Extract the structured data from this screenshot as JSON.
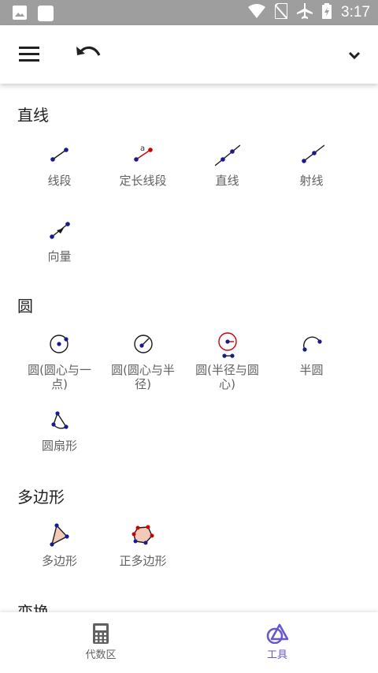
{
  "status_bar": {
    "time": "3:17",
    "icons": [
      "image-icon",
      "square-icon",
      "wifi-icon",
      "no-sim-icon",
      "airplane-icon",
      "battery-icon"
    ]
  },
  "toolbar": {
    "icons": [
      "menu-icon",
      "undo-icon",
      "chevron-down-icon"
    ]
  },
  "sections": [
    {
      "title": "直线",
      "tools": [
        {
          "label": "线段"
        },
        {
          "label": "定长线段",
          "glyph": "a"
        },
        {
          "label": "直线"
        },
        {
          "label": "射线"
        },
        {
          "label": "向量"
        }
      ]
    },
    {
      "title": "圆",
      "tools": [
        {
          "label": "圆(圆心与一",
          "label2": "点)"
        },
        {
          "label": "圆(圆心与半",
          "label2": "径)"
        },
        {
          "label": "圆(半径与圆",
          "label2": "心)"
        },
        {
          "label": "半圆"
        },
        {
          "label": "圆扇形"
        }
      ]
    },
    {
      "title": "多边形",
      "tools": [
        {
          "label": "多边形"
        },
        {
          "label": "正多边形"
        }
      ]
    },
    {
      "title": "变换"
    }
  ],
  "bottom_nav": [
    {
      "label": "代数区",
      "icon": "calculator-icon"
    },
    {
      "label": "工具",
      "icon": "tools-icon",
      "active": true
    }
  ],
  "colors": {
    "accent": "#6557d2",
    "point": "#1a1a8c",
    "red": "#cc0000",
    "polygon_fill": "#f3c9b8",
    "status_bar": "#9e9e9e"
  }
}
